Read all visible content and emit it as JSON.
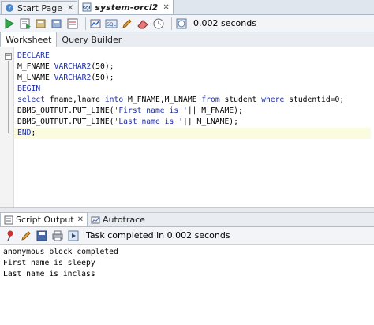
{
  "doc_tabs": [
    {
      "label": "Start Page",
      "active": false
    },
    {
      "label": "system-orcl2",
      "active": true
    }
  ],
  "toolbar": {
    "time_label": "0.002 seconds"
  },
  "worksheet_tabs": [
    {
      "label": "Worksheet",
      "active": true
    },
    {
      "label": "Query Builder",
      "active": false
    }
  ],
  "editor": {
    "lines": [
      {
        "kw": "DECLARE",
        "rest": ""
      },
      {
        "pre": "M_FNAME ",
        "kw": "VARCHAR2",
        "rest": "(50);"
      },
      {
        "pre": "M_LNAME ",
        "kw": "VARCHAR2",
        "rest": "(50);"
      },
      {
        "kw": "BEGIN",
        "rest": ""
      },
      {
        "kw": "select",
        "rest": " fname,lname ",
        "kw2": "into",
        "rest2": " M_FNAME,M_LNAME ",
        "kw3": "from",
        "rest3": " student ",
        "kw4": "where",
        "rest4": " studentid=0;"
      },
      {
        "pre": "DBMS_OUTPUT.PUT_LINE(",
        "str": "'First name is '",
        "rest": "|| M_FNAME);"
      },
      {
        "pre": "DBMS_OUTPUT.PUT_LINE(",
        "str": "'Last name is '",
        "rest": "|| M_LNAME);"
      },
      {
        "kw": "END",
        "rest": ";"
      }
    ]
  },
  "output_tabs": [
    {
      "label": "Script Output",
      "active": true
    },
    {
      "label": "Autotrace",
      "active": false
    }
  ],
  "output_toolbar": {
    "status": "Task completed in 0.002 seconds"
  },
  "output": {
    "lines": [
      "anonymous block completed",
      "First name is sleepy",
      "Last name is inclass"
    ]
  },
  "colors": {
    "keyword": "#1f2fa5",
    "current_line": "#fbfbdf"
  }
}
